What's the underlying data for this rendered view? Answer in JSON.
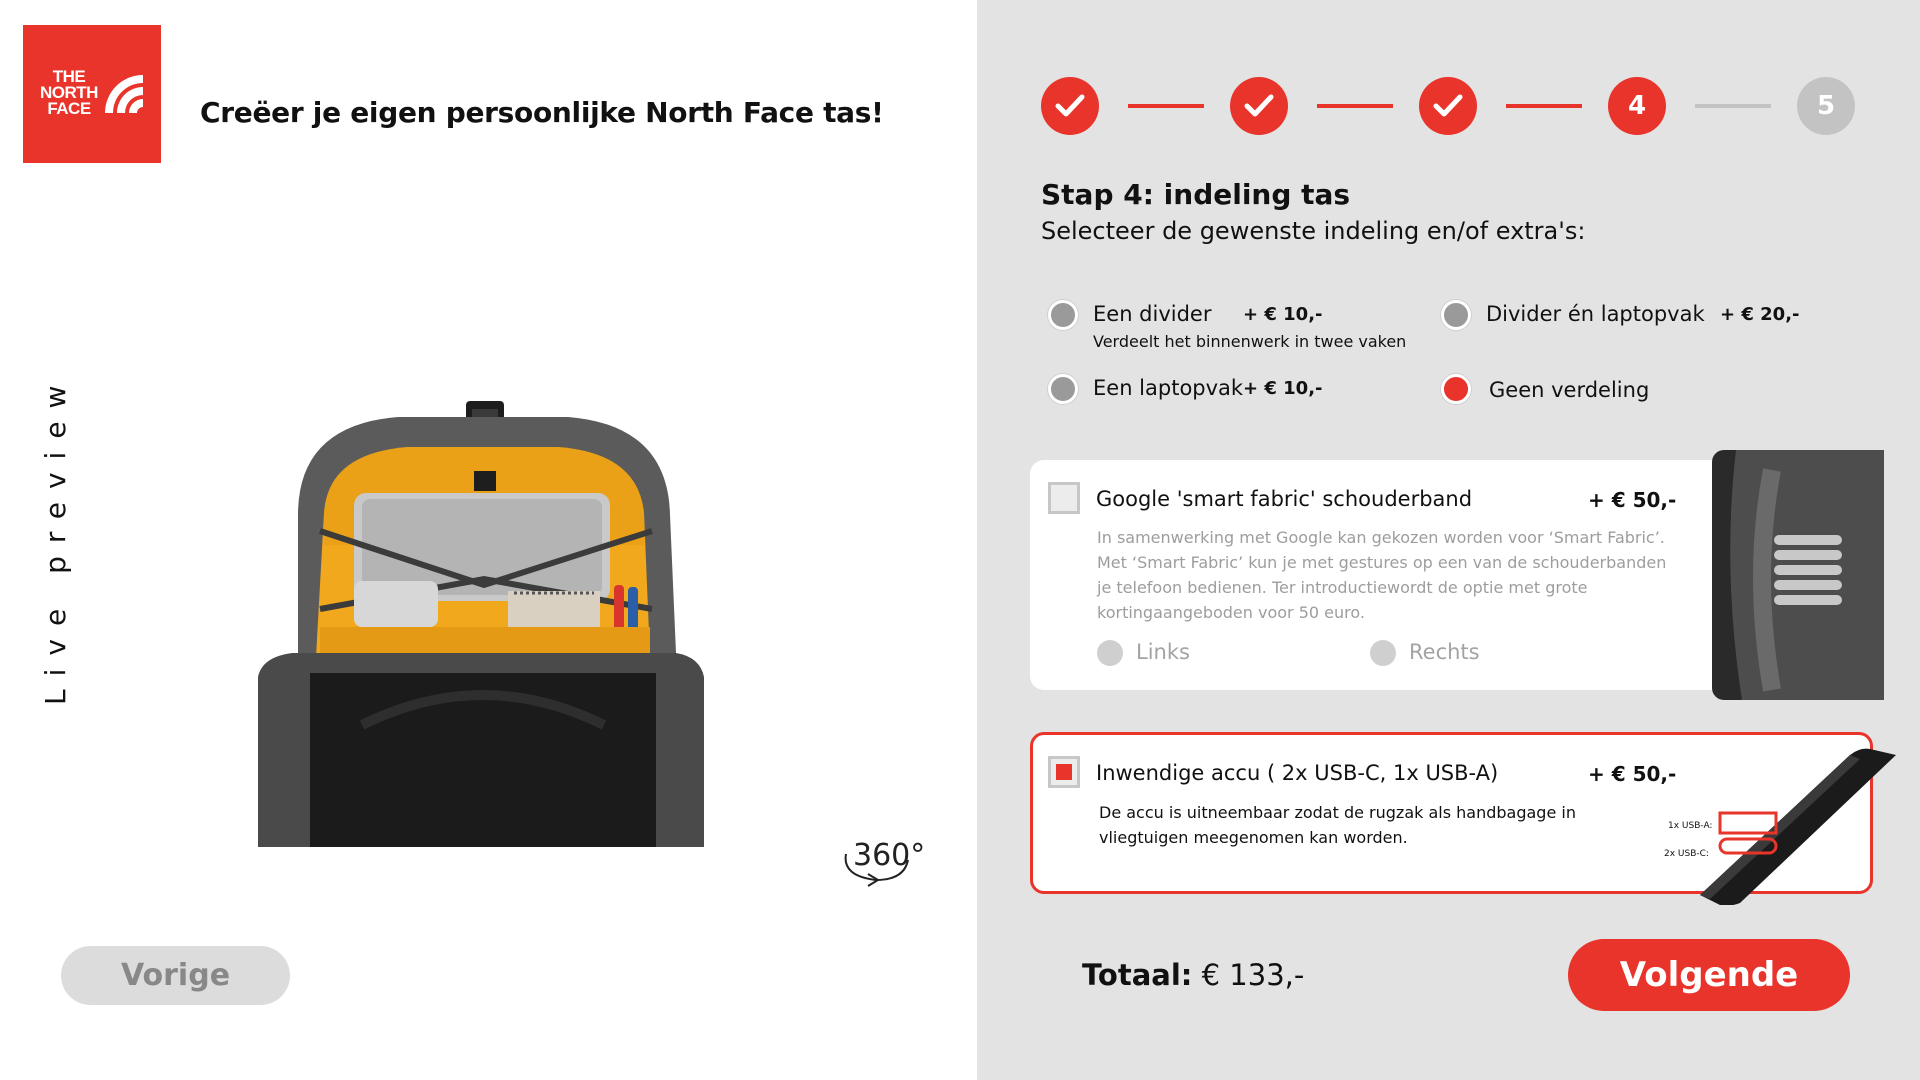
{
  "brand": {
    "logo_text": "THE NORTH FACE",
    "color": "#e8342b"
  },
  "header": {
    "title": "Creëer je eigen persoonlijke North Face tas!"
  },
  "preview": {
    "label": "Live preview",
    "rotate_label": "360°"
  },
  "nav": {
    "prev_label": "Vorige",
    "next_label": "Volgende"
  },
  "steps": [
    {
      "state": "done",
      "icon": "check-icon"
    },
    {
      "state": "done",
      "icon": "check-icon"
    },
    {
      "state": "done",
      "icon": "check-icon"
    },
    {
      "number": "4",
      "state": "current"
    },
    {
      "number": "5",
      "state": "pending"
    }
  ],
  "step": {
    "title": "Stap 4: indeling tas",
    "subtitle": "Selecteer de gewenste indeling en/of extra's:"
  },
  "options": [
    {
      "label": "Een divider",
      "price": "+ € 10,-",
      "description": "Verdeelt het binnenwerk in twee vaken",
      "selected": false
    },
    {
      "label": "Divider én laptopvak",
      "price": "+ € 20,-",
      "selected": false
    },
    {
      "label": "Een laptopvak",
      "price": "+ € 10,-",
      "selected": false
    },
    {
      "label": "Geen verdeling",
      "selected": true
    }
  ],
  "extras": [
    {
      "title": "Google 'smart fabric' schouderband",
      "price": "+ € 50,-",
      "checked": false,
      "description": "In samenwerking met Google kan gekozen worden voor ‘Smart Fabric’. Met ‘Smart Fabric’ kun je met gestures op een van de schouderbanden je telefoon bedienen. Ter introductiewordt de optie met grote kortingaangeboden voor 50 euro.",
      "sides": [
        "Links",
        "Rechts"
      ]
    },
    {
      "title": "Inwendige accu ( 2x USB-C, 1x USB-A)",
      "price": "+ € 50,-",
      "checked": true,
      "description": "De accu is uitneembaar zodat de rugzak als handbagage in vliegtuigen meegenomen kan worden.",
      "port_labels": [
        "1x USB-A:",
        "2x USB-C:"
      ]
    }
  ],
  "total": {
    "label": "Totaal:",
    "value": "€ 133,-"
  }
}
